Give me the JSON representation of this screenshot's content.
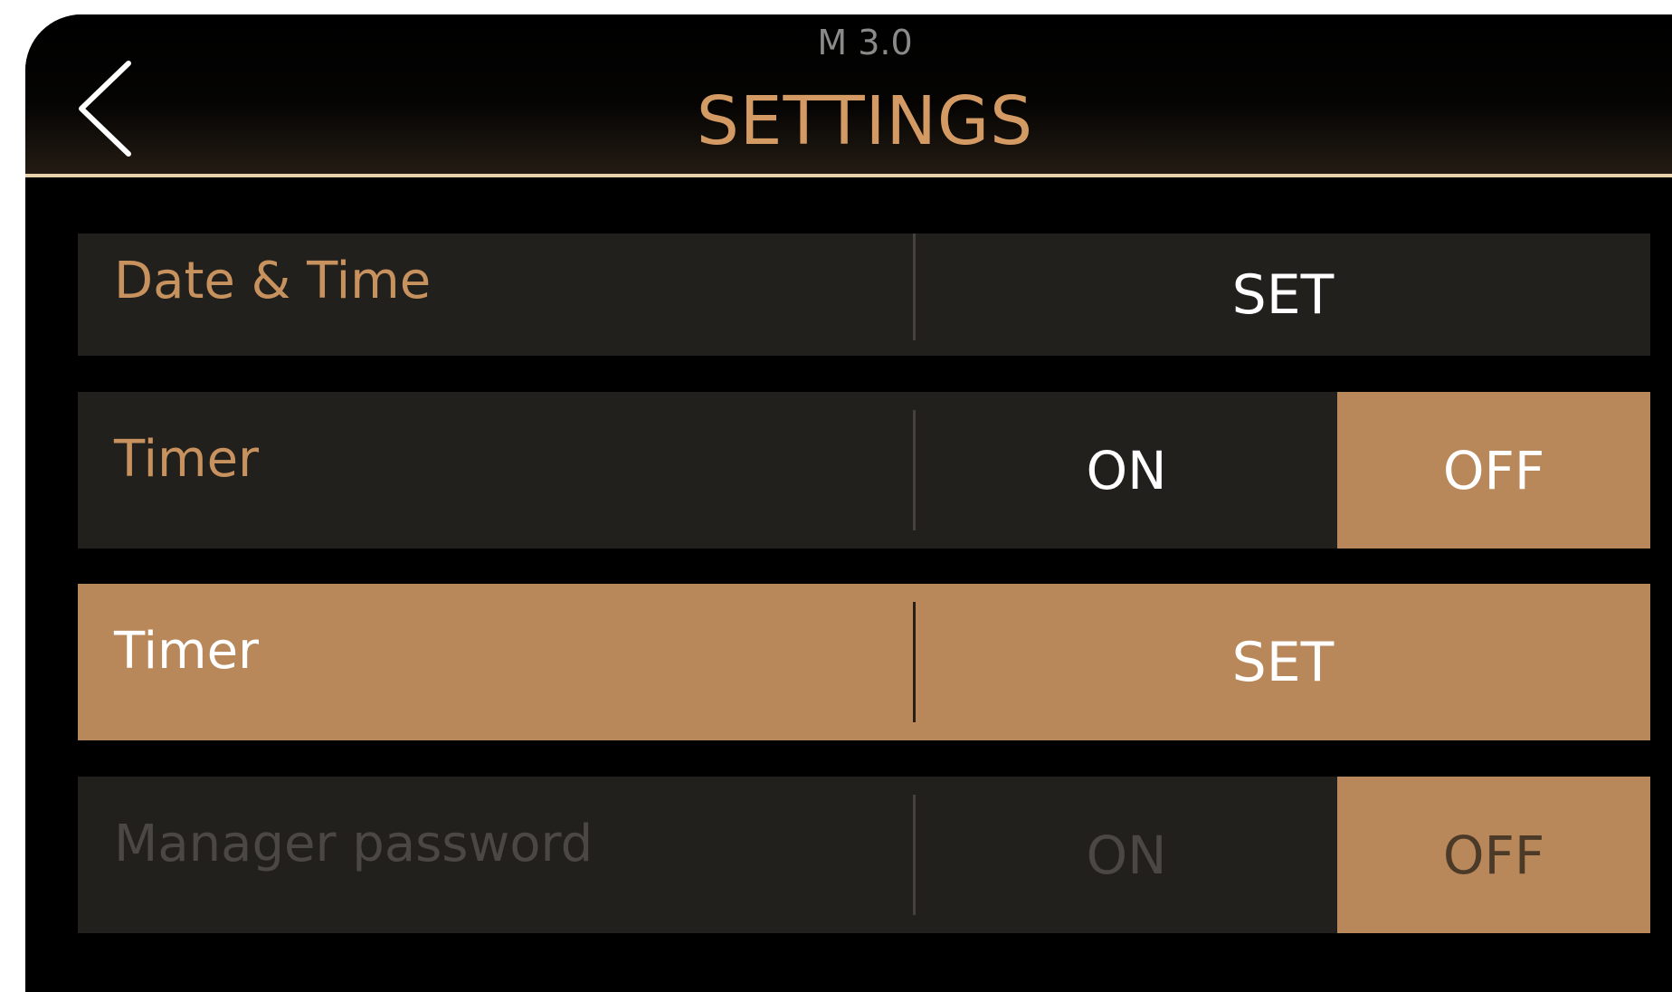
{
  "header": {
    "version": "M 3.0",
    "title": "SETTINGS",
    "back_icon": "chevron-left-icon"
  },
  "rows": [
    {
      "label": "Date & Time",
      "control": "set",
      "set_label": "SET",
      "active": false,
      "disabled": false
    },
    {
      "label": "Timer",
      "control": "toggle",
      "on_label": "ON",
      "off_label": "OFF",
      "selected": "OFF",
      "active": false,
      "disabled": false
    },
    {
      "label": "Timer",
      "control": "set",
      "set_label": "SET",
      "active": true,
      "disabled": false
    },
    {
      "label": "Manager password",
      "control": "toggle",
      "on_label": "ON",
      "off_label": "OFF",
      "selected": "OFF",
      "active": false,
      "disabled": true
    }
  ],
  "colors": {
    "accent": "#b8875a",
    "title": "#d49a64",
    "row_bg": "#22201d",
    "header_line": "#e8d3ac"
  }
}
